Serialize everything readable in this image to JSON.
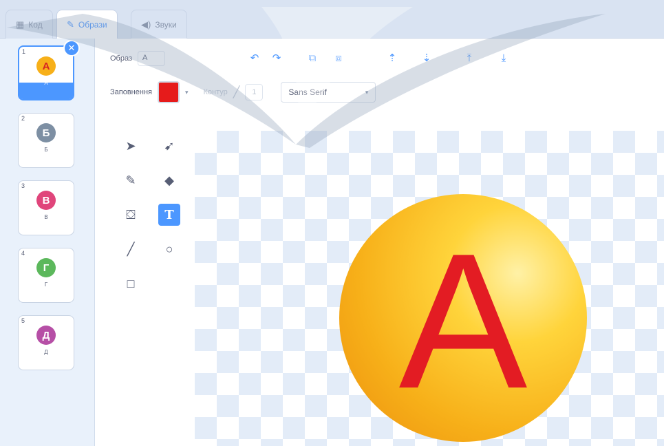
{
  "tabs": [
    {
      "label": "Код",
      "icon": "code-icon"
    },
    {
      "label": "Образи",
      "icon": "brush-icon"
    },
    {
      "label": "Звуки",
      "icon": "speaker-icon"
    }
  ],
  "costumes": [
    {
      "num": "1",
      "name": "A",
      "size": "",
      "letter": "A",
      "color": "#f7b019"
    },
    {
      "num": "2",
      "name": "Б",
      "size": "",
      "letter": "Б",
      "color": "#7d8fa3"
    },
    {
      "num": "3",
      "name": "В",
      "size": "",
      "letter": "В",
      "color": "#e0457b"
    },
    {
      "num": "4",
      "name": "Г",
      "size": "",
      "letter": "Г",
      "color": "#5cb85c"
    },
    {
      "num": "5",
      "name": "Д",
      "size": "",
      "letter": "Д",
      "color": "#b64fa6"
    }
  ],
  "editor": {
    "costume_label": "Образ",
    "costume_name": "A",
    "fill_label": "Заповнення",
    "fill_color": "#e61b1b",
    "outline_label": "Контур",
    "outline_width": "1",
    "font": "Sans Serif"
  },
  "canvas_letter": "A"
}
